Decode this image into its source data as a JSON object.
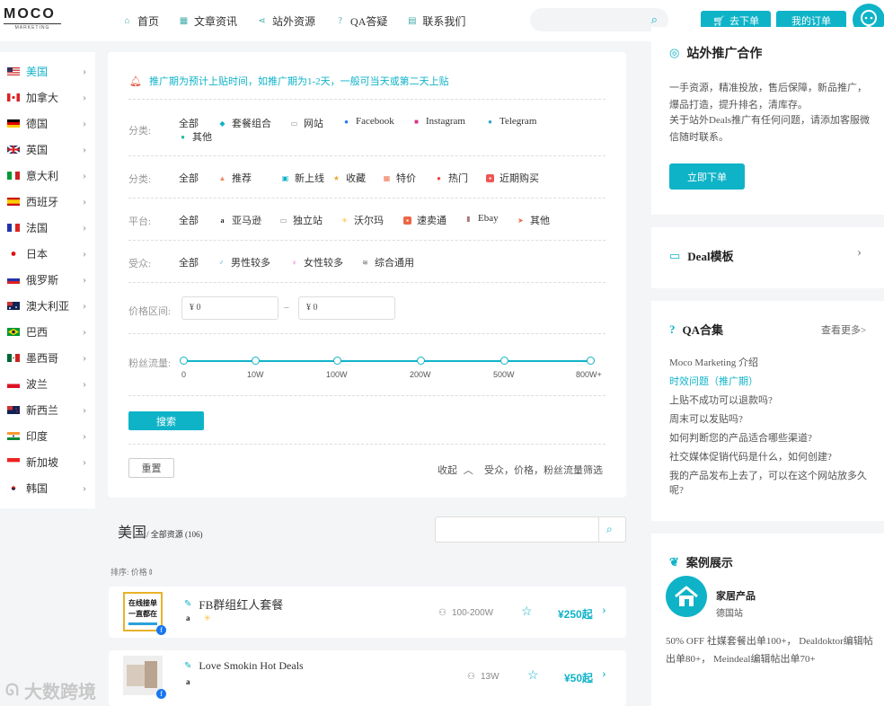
{
  "logo": {
    "main": "MOCO",
    "sub": "MARKETING"
  },
  "nav": [
    {
      "label": "首页",
      "icon": "home-icon"
    },
    {
      "label": "文章资讯",
      "icon": "grid-icon"
    },
    {
      "label": "站外资源",
      "icon": "share-icon"
    },
    {
      "label": "QA答疑",
      "icon": "question-icon"
    },
    {
      "label": "联系我们",
      "icon": "contact-icon"
    }
  ],
  "header": {
    "search_placeholder": "",
    "order_btn": "去下单",
    "my_orders_btn": "我的订单"
  },
  "countries": [
    "美国",
    "加拿大",
    "德国",
    "英国",
    "意大利",
    "西班牙",
    "法国",
    "日本",
    "俄罗斯",
    "澳大利亚",
    "巴西",
    "墨西哥",
    "波兰",
    "新西兰",
    "印度",
    "新加坡",
    "韩国"
  ],
  "filter": {
    "notice": "推广期为预计上贴时间，如推广期为1-2天，一般可当天或第二天上贴",
    "cat1_label": "分类:",
    "cat1_options": [
      "全部",
      "套餐组合",
      "网站",
      "Facebook",
      "Instagram",
      "Telegram",
      "其他"
    ],
    "cat2_label": "分类:",
    "cat2_options": [
      "全部",
      "推荐",
      "新上线",
      "收藏",
      "特价",
      "热门",
      "近期购买"
    ],
    "platform_label": "平台:",
    "platform_options": [
      "全部",
      "亚马逊",
      "独立站",
      "沃尔玛",
      "速卖通",
      "Ebay",
      "其他"
    ],
    "audience_label": "受众:",
    "audience_options": [
      "全部",
      "男性较多",
      "女性较多",
      "综合通用"
    ],
    "price_label": "价格区间:",
    "price_min": "¥ 0",
    "price_max": "¥ 0",
    "price_sep": "–",
    "fans_label": "粉丝流量:",
    "fans_ticks": [
      "0",
      "10W",
      "100W",
      "200W",
      "500W",
      "800W+"
    ],
    "search_btn": "搜索",
    "reset_btn": "重置",
    "collapse": "收起",
    "collapse_hint": "受众，价格，粉丝流量筛选"
  },
  "results": {
    "country": "美国",
    "subtitle": "/ 全部资源 (106)",
    "sort": "排序: 价格",
    "items": [
      {
        "title": "FB群组红人套餐",
        "thumb_text1": "在线接单",
        "thumb_text2": "一直都在",
        "fans": "100-200W",
        "price": "¥250起"
      },
      {
        "title": "Love Smokin Hot Deals",
        "thumb_text1": "",
        "thumb_text2": "",
        "fans": "13W",
        "price": "¥50起"
      }
    ]
  },
  "right": {
    "promo_title": "站外推广合作",
    "promo_text": "一手资源，精准投放，售后保障，新品推广，爆品打造，提升排名，清库存。",
    "promo_contact": "关于站外Deals推广有任何问题，请添加客服微信随时联系。",
    "promo_btn": "立即下单",
    "deal_title": "Deal模板",
    "qa_title": "QA合集",
    "qa_more": "查看更多>",
    "qa_items": [
      "Moco Marketing 介绍",
      "时效问题（推广期）",
      "上贴不成功可以退款吗?",
      "周末可以发贴吗?",
      "如何判断您的产品适合哪些渠道?",
      "社交媒体促销代码是什么，如何创建?",
      "我的产品发布上去了，可以在这个网站放多久呢?"
    ],
    "case_title": "案例展示",
    "case_name": "家居产品",
    "case_site": "德国站",
    "case_text": "50% OFF 社媒套餐出单100+， Dealdoktor编辑帖出单80+， Meindeal编辑帖出单70+"
  },
  "watermark": "大数跨境",
  "colors": {
    "accent": "#0fb3c8",
    "notice_icon": "#e0533a"
  }
}
